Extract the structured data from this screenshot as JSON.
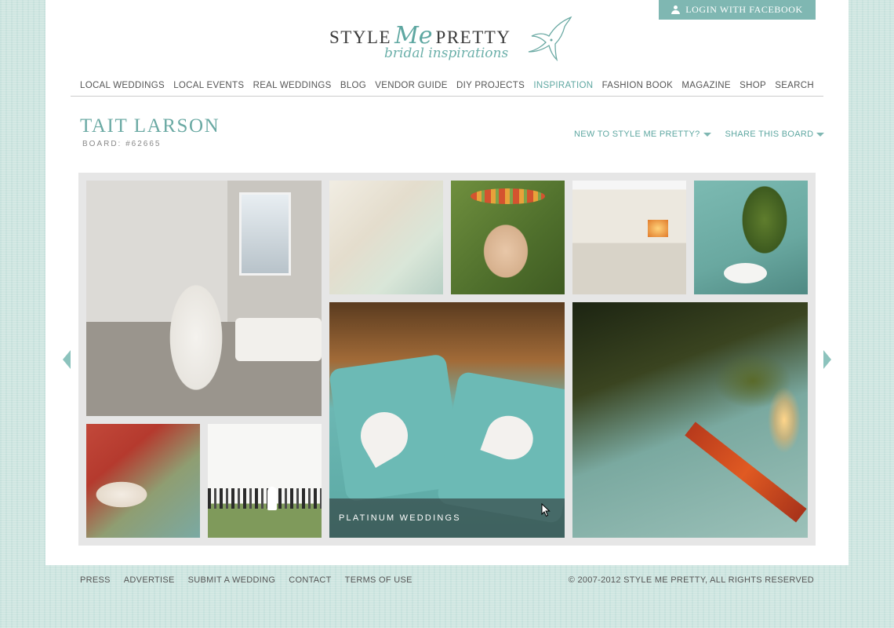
{
  "header": {
    "login_label": "LOGIN WITH FACEBOOK",
    "logo": {
      "word_left": "STYLE",
      "word_me": "Me",
      "word_right": "PRETTY",
      "tagline": "bridal inspirations"
    }
  },
  "nav": {
    "items": [
      "LOCAL WEDDINGS",
      "LOCAL EVENTS",
      "REAL WEDDINGS",
      "BLOG",
      "VENDOR GUIDE",
      "DIY PROJECTS",
      "INSPIRATION",
      "FASHION BOOK",
      "MAGAZINE",
      "SHOP",
      "SEARCH"
    ],
    "active": "INSPIRATION"
  },
  "board": {
    "title": "TAIT LARSON",
    "number": "BOARD: #62665",
    "new_label": "NEW TO STYLE ME PRETTY?",
    "share_label": "SHARE THIS BOARD"
  },
  "gallery": {
    "hover_caption": "PLATINUM WEDDINGS"
  },
  "footer": {
    "links": [
      "PRESS",
      "ADVERTISE",
      "SUBMIT A WEDDING",
      "CONTACT",
      "TERMS OF USE"
    ],
    "copyright": "© 2007-2012 STYLE ME PRETTY, ALL RIGHTS RESERVED"
  },
  "colors": {
    "accent": "#6aa9a3",
    "background": "#cfe6e1",
    "login_bg": "#7fb7b2"
  },
  "icons": {
    "login": "user-icon",
    "dropdown": "caret-down-icon",
    "prev": "arrow-left-icon",
    "next": "arrow-right-icon",
    "logo_bird": "hummingbird-icon"
  }
}
